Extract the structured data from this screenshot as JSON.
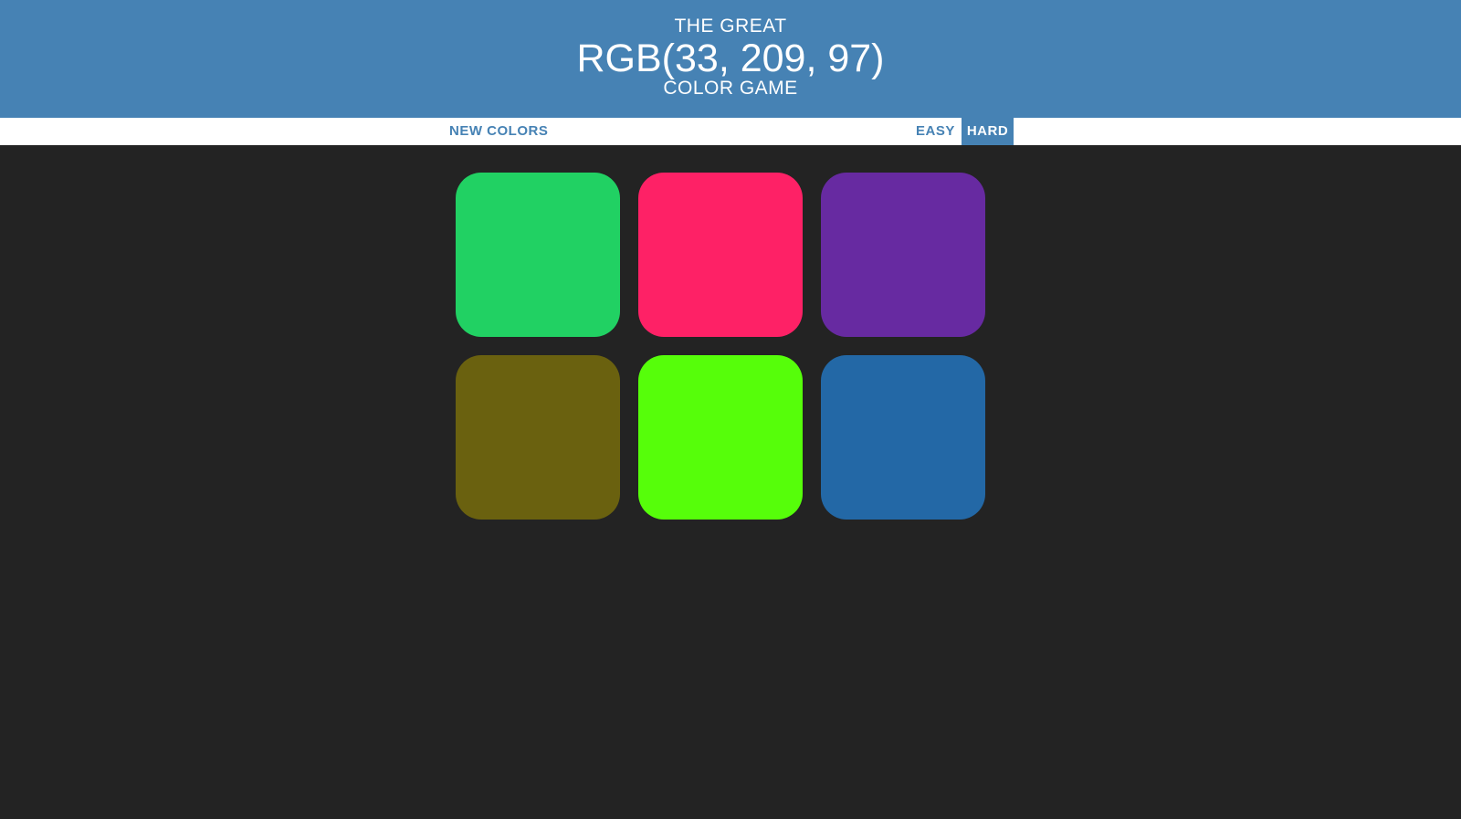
{
  "header": {
    "line1": "THE GREAT",
    "color_display": "RGB(33, 209, 97)",
    "line3": "COLOR GAME",
    "background": "#4682b4"
  },
  "controls": {
    "new_colors_label": "NEW COLORS",
    "easy_label": "EASY",
    "hard_label": "HARD",
    "selected_mode": "HARD"
  },
  "squares": [
    {
      "color": "#21d163"
    },
    {
      "color": "#fe2166"
    },
    {
      "color": "#672aa1"
    },
    {
      "color": "#6a610f"
    },
    {
      "color": "#56fe0a"
    },
    {
      "color": "#2368a6"
    }
  ],
  "background": "#232323"
}
